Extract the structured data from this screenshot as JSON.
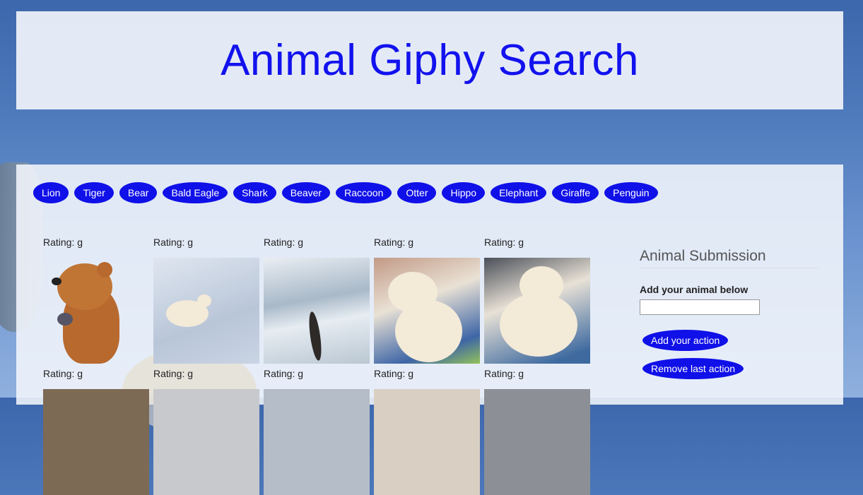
{
  "header": {
    "title": "Animal Giphy Search"
  },
  "animals": [
    "Lion",
    "Tiger",
    "Bear",
    "Bald Eagle",
    "Shark",
    "Beaver",
    "Raccoon",
    "Otter",
    "Hippo",
    "Elephant",
    "Giraffe",
    "Penguin"
  ],
  "gifs": [
    {
      "rating": "Rating: g",
      "icon": "cartoon-bear"
    },
    {
      "rating": "Rating: g",
      "icon": "polar-bear-snow"
    },
    {
      "rating": "Rating: g",
      "icon": "seal-in-water"
    },
    {
      "rating": "Rating: g",
      "icon": "polar-bear-cub"
    },
    {
      "rating": "Rating: g",
      "icon": "polar-bear-cub"
    },
    {
      "rating": "Rating: g",
      "icon": "gif-thumbnail"
    },
    {
      "rating": "Rating: g",
      "icon": "gif-thumbnail"
    },
    {
      "rating": "Rating: g",
      "icon": "gif-thumbnail"
    },
    {
      "rating": "Rating: g",
      "icon": "gif-thumbnail"
    },
    {
      "rating": "Rating: g",
      "icon": "gif-thumbnail"
    }
  ],
  "sidebar": {
    "title": "Animal Submission",
    "input_label": "Add your animal below",
    "input_value": "",
    "add_button": "Add your action",
    "remove_button": "Remove last action"
  },
  "colors": {
    "accent": "#1010e8",
    "title": "#1212ee"
  }
}
